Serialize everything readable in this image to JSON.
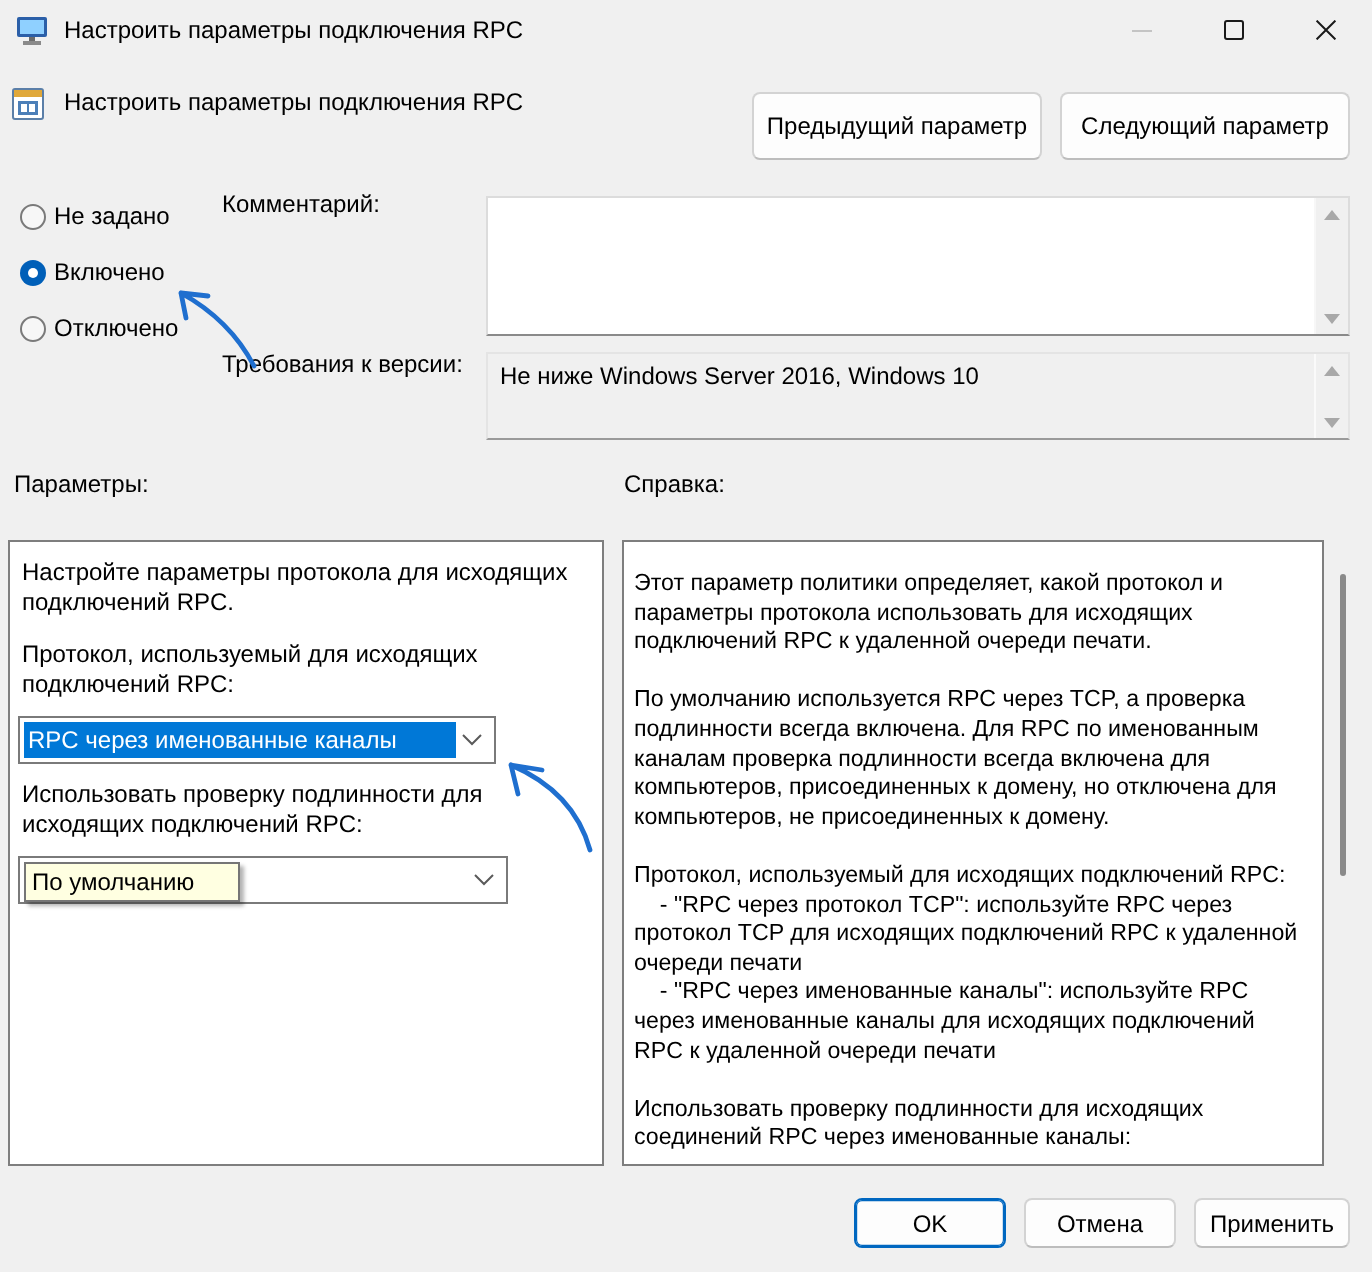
{
  "window": {
    "title": "Настроить параметры подключения RPC",
    "controls": [
      {
        "kind": "minimize",
        "disabled": true
      },
      {
        "kind": "maximize",
        "disabled": false
      },
      {
        "kind": "close",
        "disabled": false
      }
    ]
  },
  "header": {
    "title": "Настроить параметры подключения RPC",
    "buttons": [
      {
        "label": "Предыдущий параметр"
      },
      {
        "label": "Следующий параметр"
      }
    ]
  },
  "state_options": [
    {
      "label": "Не задано",
      "selected": false
    },
    {
      "label": "Включено",
      "selected": true
    },
    {
      "label": "Отключено",
      "selected": false
    }
  ],
  "comment": {
    "label": "Комментарий:"
  },
  "version": {
    "label": "Требования к версии:",
    "value": "Не ниже Windows Server 2016, Windows 10"
  },
  "options": {
    "label": "Параметры:",
    "items": [
      {
        "kind": "text",
        "text": "Настройте параметры протокола для исходящих\nподключений RPC."
      },
      {
        "kind": "text",
        "text": "Протокол, используемый для исходящих\nподключений RPC:"
      },
      {
        "kind": "dropdown",
        "value": "RPC через именованные каналы",
        "highlighted": true,
        "tooltip": false
      },
      {
        "kind": "text",
        "text": "Использовать проверку подлинности для\nисходящих подключений RPC:"
      },
      {
        "kind": "dropdown",
        "value": "По умолчанию",
        "highlighted": false,
        "tooltip": true
      }
    ]
  },
  "help": {
    "label": "Справка:",
    "paragraphs": [
      "Этот параметр политики определяет, какой протокол и\nпараметры протокола использовать для исходящих\nподключений RPC к удаленной очереди печати.",
      "По умолчанию используется RPC через TCP, а проверка\nподлинности всегда включена. Для RPC по именованным\nканалам проверка подлинности всегда включена для\nкомпьютеров, присоединенных к домену, но отключена для\nкомпьютеров, не присоединенных к домену.",
      "Протокол, используемый для исходящих подключений RPC:\n    - \"RPC через протокол TCP\": используйте RPC через\nпротокол TCP для исходящих подключений RPC к удаленной\nочереди печати\n    - \"RPC через именованные каналы\": используйте RPC\nчерез именованные каналы для исходящих подключений\nRPC к удаленной очереди печати",
      "Использовать проверку подлинности для исходящих\nсоединений RPC через именованные каналы:"
    ]
  },
  "footer_buttons": [
    {
      "label": "OK",
      "default": true
    },
    {
      "label": "Отмена",
      "default": false
    },
    {
      "label": "Применить",
      "default": false
    }
  ]
}
